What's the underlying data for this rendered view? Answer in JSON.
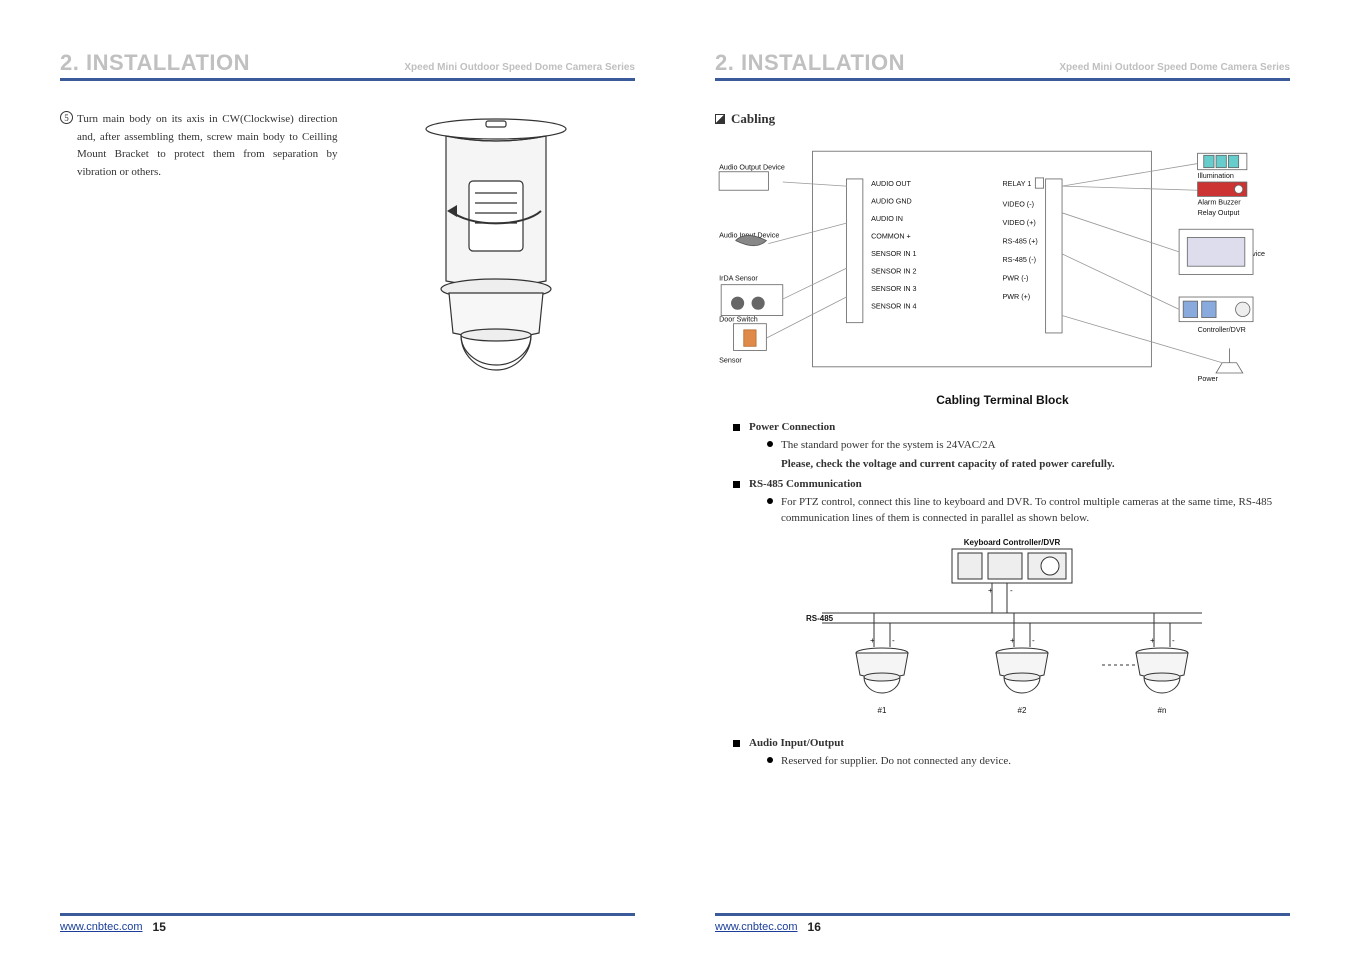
{
  "chapter": "2. INSTALLATION",
  "series": "Xpeed Mini Outdoor Speed Dome Camera Series",
  "left_page": {
    "step_num": "5",
    "step_text": "Turn main body on its axis in CW(Clockwise) direction and, after assembling them, screw main body to Ceilling Mount Bracket to protect them from separation by vibration or others."
  },
  "right_page": {
    "section": "Cabling",
    "cabling_block": {
      "caption": "Cabling Terminal Block",
      "left_labels": [
        "Audio Output Device",
        "Audio Input Device",
        "IrDA Sensor",
        "Door Switch",
        "Sensor"
      ],
      "col_a": [
        "AUDIO OUT",
        "AUDIO GND",
        "AUDIO IN",
        "COMMON +",
        "SENSOR IN 1",
        "SENSOR IN 2",
        "SENSOR IN 3",
        "SENSOR IN 4"
      ],
      "col_b_header": "RELAY 1",
      "col_b": [
        "VIDEO (-)",
        "VIDEO (+)",
        "RS-485 (+)",
        "RS-485 (-)",
        "PWR (-)",
        "PWR (+)"
      ],
      "right_labels": [
        "Illumination",
        "Alarm Buzzer",
        "Relay Output",
        "Image Output Device",
        "Controller/DVR",
        "Power"
      ]
    },
    "items": [
      {
        "title": "Power Connection",
        "points": [
          "The standard power for the system is 24VAC/2A"
        ],
        "note": "Please, check the voltage and current capacity of rated power carefully."
      },
      {
        "title": "RS-485 Communication",
        "points": [
          "For PTZ control, connect this line to keyboard and DVR. To control multiple cameras at the same time, RS-485 communication lines of them is connected in parallel as shown below."
        ],
        "diagram": {
          "top_label": "Keyboard Controller/DVR",
          "bus_label": "RS-485",
          "nodes": [
            "#1",
            "#2",
            "#n"
          ]
        }
      },
      {
        "title": "Audio Input/Output",
        "points": [
          "Reserved for supplier. Do not connected any device."
        ]
      }
    ]
  },
  "footer": {
    "url": "www.cnbtec.com",
    "page_left": "15",
    "page_right": "16"
  }
}
